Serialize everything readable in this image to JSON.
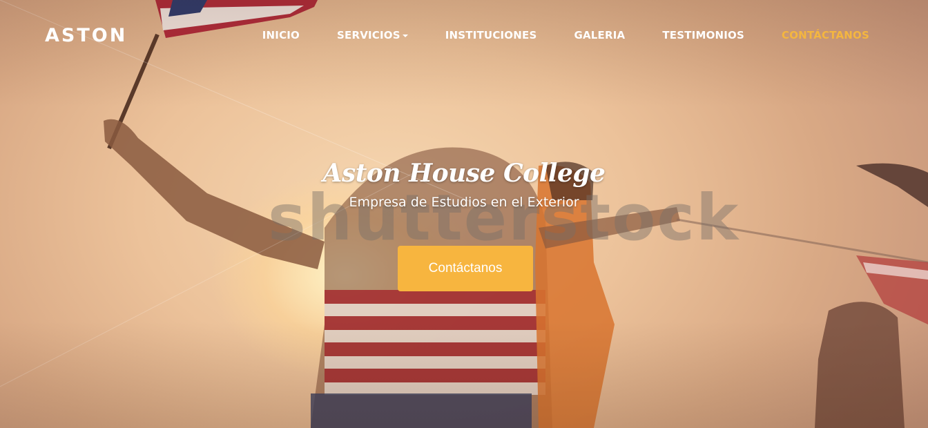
{
  "brand": {
    "name": "ASTON"
  },
  "nav": {
    "items": [
      {
        "label": "INICIO"
      },
      {
        "label": "SERVICIOS"
      },
      {
        "label": "INSTITUCIONES"
      },
      {
        "label": "GALERIA"
      },
      {
        "label": "TESTIMONIOS"
      },
      {
        "label": "CONTÁCTANOS"
      }
    ],
    "active_color": "#f4b63f"
  },
  "hero": {
    "title": "Aston House College",
    "subtitle": "Empresa de Estudios en el Exterior",
    "cta_label": "Contáctanos",
    "cta_color": "#f7b53f",
    "watermark": "shutterstock"
  }
}
